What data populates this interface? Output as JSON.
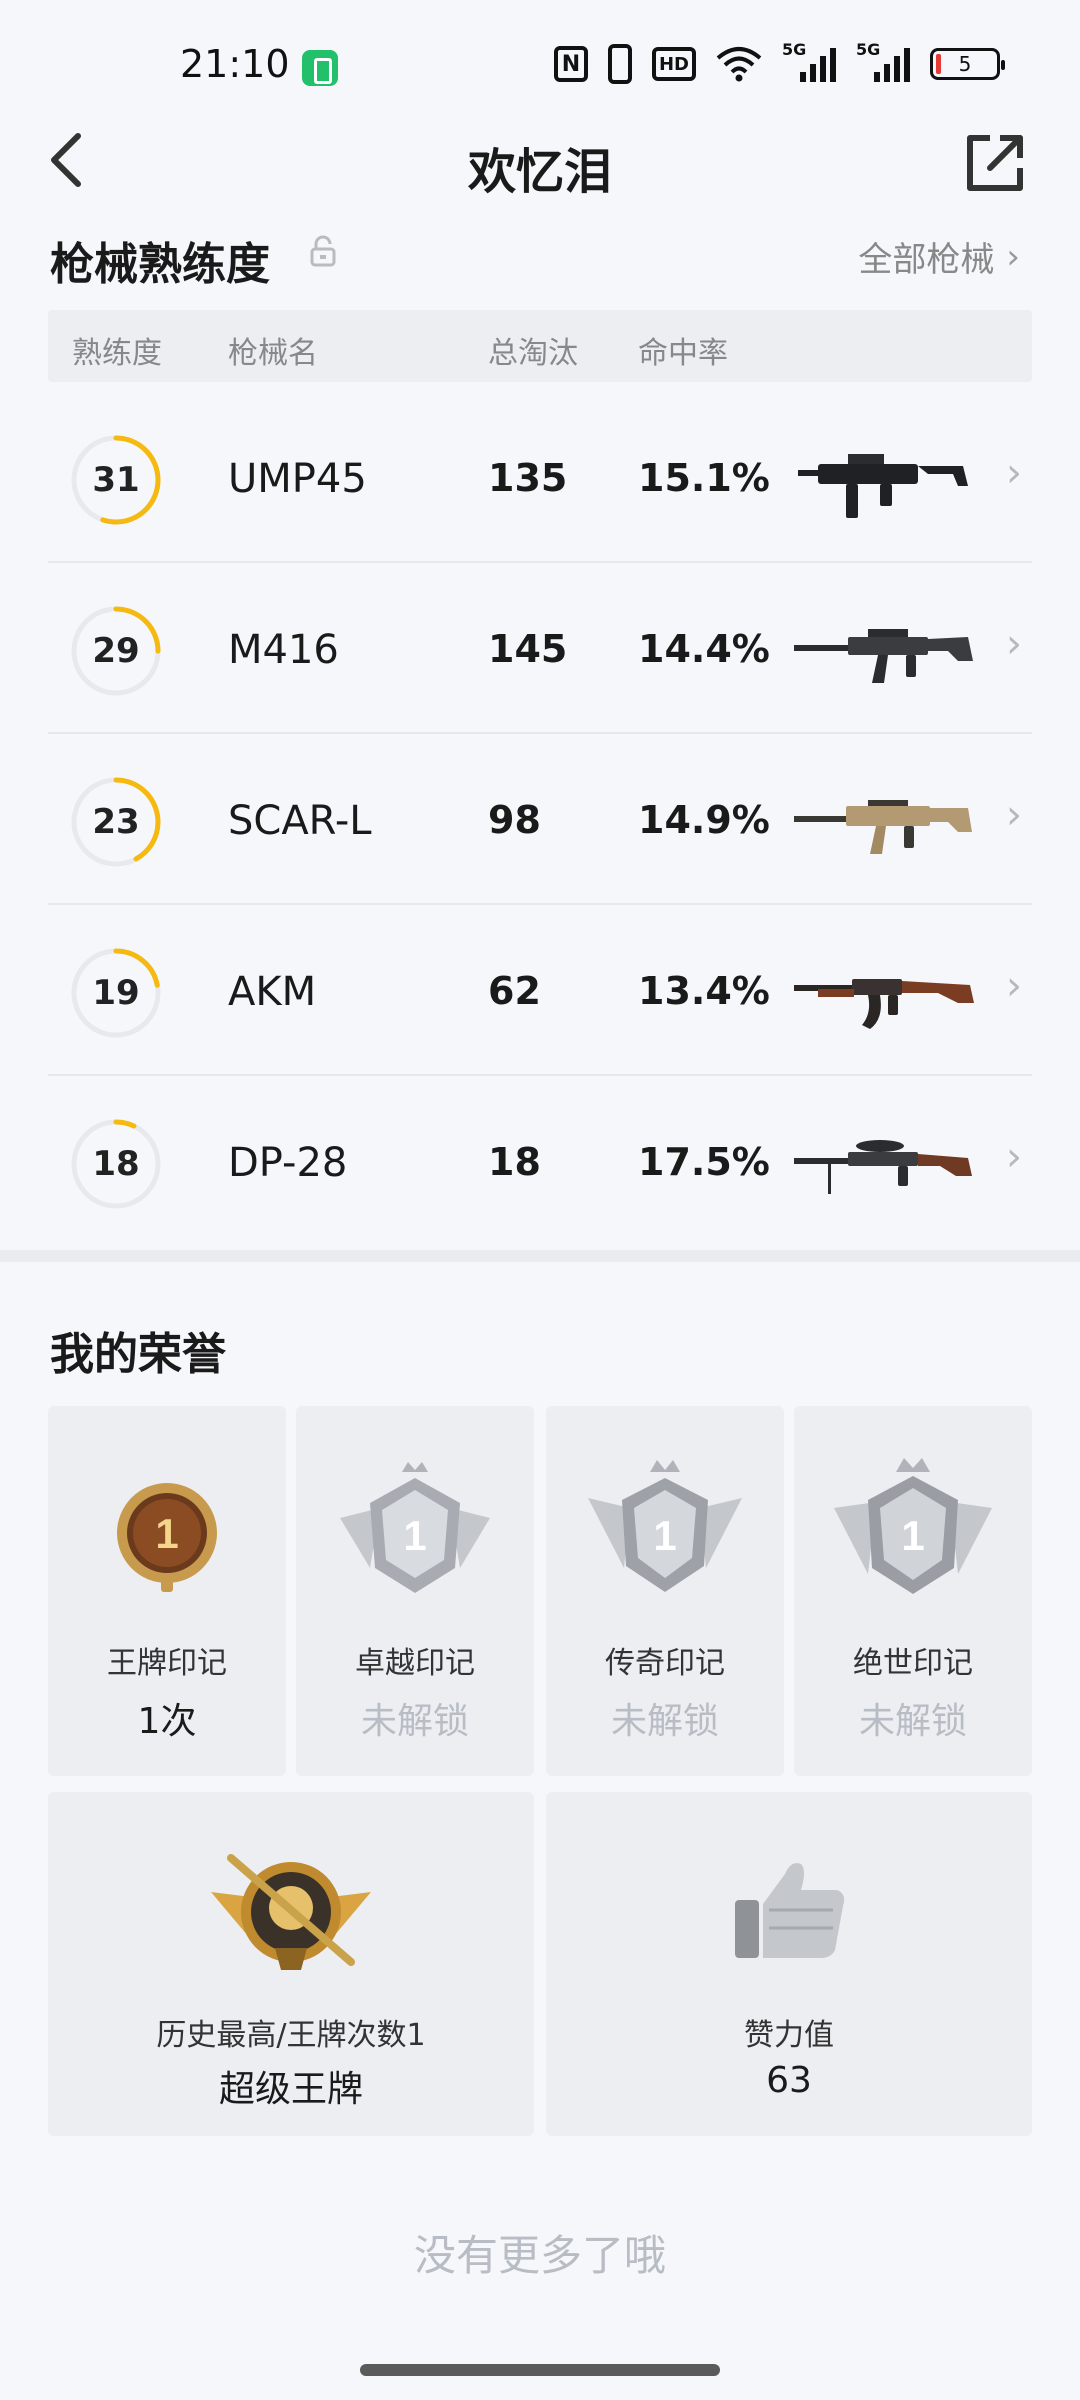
{
  "status_bar": {
    "time": "21:10",
    "nfc_label": "N",
    "hd_label": "HD",
    "signal1_label": "5G",
    "signal2_label": "5G",
    "battery_level": "5",
    "battery_charging_color": "#22c06a",
    "battery_low_color": "#e53935"
  },
  "header": {
    "title": "欢忆泪",
    "back_icon": "back-arrow-icon",
    "share_icon": "share-external-icon"
  },
  "weapon_section": {
    "title": "枪械熟练度",
    "lock_icon": "lock-icon",
    "all_link": "全部枪械",
    "columns": [
      "熟练度",
      "枪械名",
      "总淘汰",
      "命中率"
    ],
    "accent_color": "#f5b90f",
    "weapons": [
      {
        "level": "31",
        "name": "UMP45",
        "kills": "135",
        "hit_rate": "15.1%",
        "progress": 0.55,
        "icon": "smg-image"
      },
      {
        "level": "29",
        "name": "M416",
        "kills": "145",
        "hit_rate": "14.4%",
        "progress": 0.25,
        "icon": "rifle-image"
      },
      {
        "level": "23",
        "name": "SCAR-L",
        "kills": "98",
        "hit_rate": "14.9%",
        "progress": 0.42,
        "icon": "rifle-tan-image"
      },
      {
        "level": "19",
        "name": "AKM",
        "kills": "62",
        "hit_rate": "13.4%",
        "progress": 0.22,
        "icon": "rifle-wood-image"
      },
      {
        "level": "18",
        "name": "DP-28",
        "kills": "18",
        "hit_rate": "17.5%",
        "progress": 0.07,
        "icon": "lmg-image"
      }
    ]
  },
  "honor_section": {
    "title": "我的荣誉",
    "badges": [
      {
        "label": "王牌印记",
        "value": "1次",
        "locked": false,
        "icon_number": "1"
      },
      {
        "label": "卓越印记",
        "value": "未解锁",
        "locked": true,
        "icon_number": "1"
      },
      {
        "label": "传奇印记",
        "value": "未解锁",
        "locked": true,
        "icon_number": "1"
      },
      {
        "label": "绝世印记",
        "value": "未解锁",
        "locked": true,
        "icon_number": "1"
      }
    ],
    "rank_card": {
      "label": "历史最高/王牌次数1",
      "value": "超级王牌"
    },
    "likes_card": {
      "label": "赞力值",
      "value": "63"
    }
  },
  "footer": {
    "no_more": "没有更多了哦"
  }
}
